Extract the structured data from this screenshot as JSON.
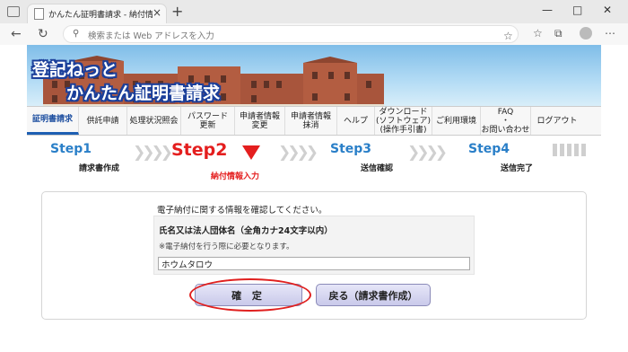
{
  "browser": {
    "tab_title": "かんたん証明書請求 - 納付情報入力",
    "tab_close": "×",
    "new_tab": "+",
    "address_placeholder": "検索または Web アドレスを入力",
    "window_controls": {
      "minimize": "—",
      "maximize": "□",
      "close": "✕"
    }
  },
  "banner": {
    "title_line1": "登記ねっと",
    "title_line2": "かんたん証明書請求"
  },
  "menu": [
    {
      "label": "証明書請求",
      "active": true
    },
    {
      "label": "供託申請",
      "active": false
    },
    {
      "label": "処理状況照会",
      "active": false
    },
    {
      "label": "パスワード\n更新",
      "active": false
    },
    {
      "label": "申請者情報\n変更",
      "active": false
    },
    {
      "label": "申請者情報\n抹消",
      "active": false
    },
    {
      "label": "ヘルプ",
      "active": false
    },
    {
      "label": "ダウンロード\n(ソフトウェア)\n(操作手引書)",
      "active": false
    },
    {
      "label": "ご利用環境",
      "active": false
    },
    {
      "label": "FAQ\n・\nお問い合わせ",
      "active": false
    },
    {
      "label": "ログアウト",
      "active": false
    }
  ],
  "steps": [
    {
      "label": "Step1",
      "sub": "請求書作成"
    },
    {
      "label": "Step2",
      "sub": "納付情報入力"
    },
    {
      "label": "Step3",
      "sub": "送信確認"
    },
    {
      "label": "Step4",
      "sub": "送信完了"
    }
  ],
  "form": {
    "instruction": "電子納付に関する情報を確認してください。",
    "field_label": "氏名又は法人団体名（全角カナ24文字以内）",
    "field_note": "※電子納付を行う際に必要となります。",
    "field_value": "ホウムタロウ",
    "confirm_label": "確 定",
    "back_label": "戻る（請求書作成）"
  },
  "colors": {
    "step_done": "#2a7fc8",
    "step_current": "#e41e1e",
    "menu_active": "#1e5fb3"
  }
}
